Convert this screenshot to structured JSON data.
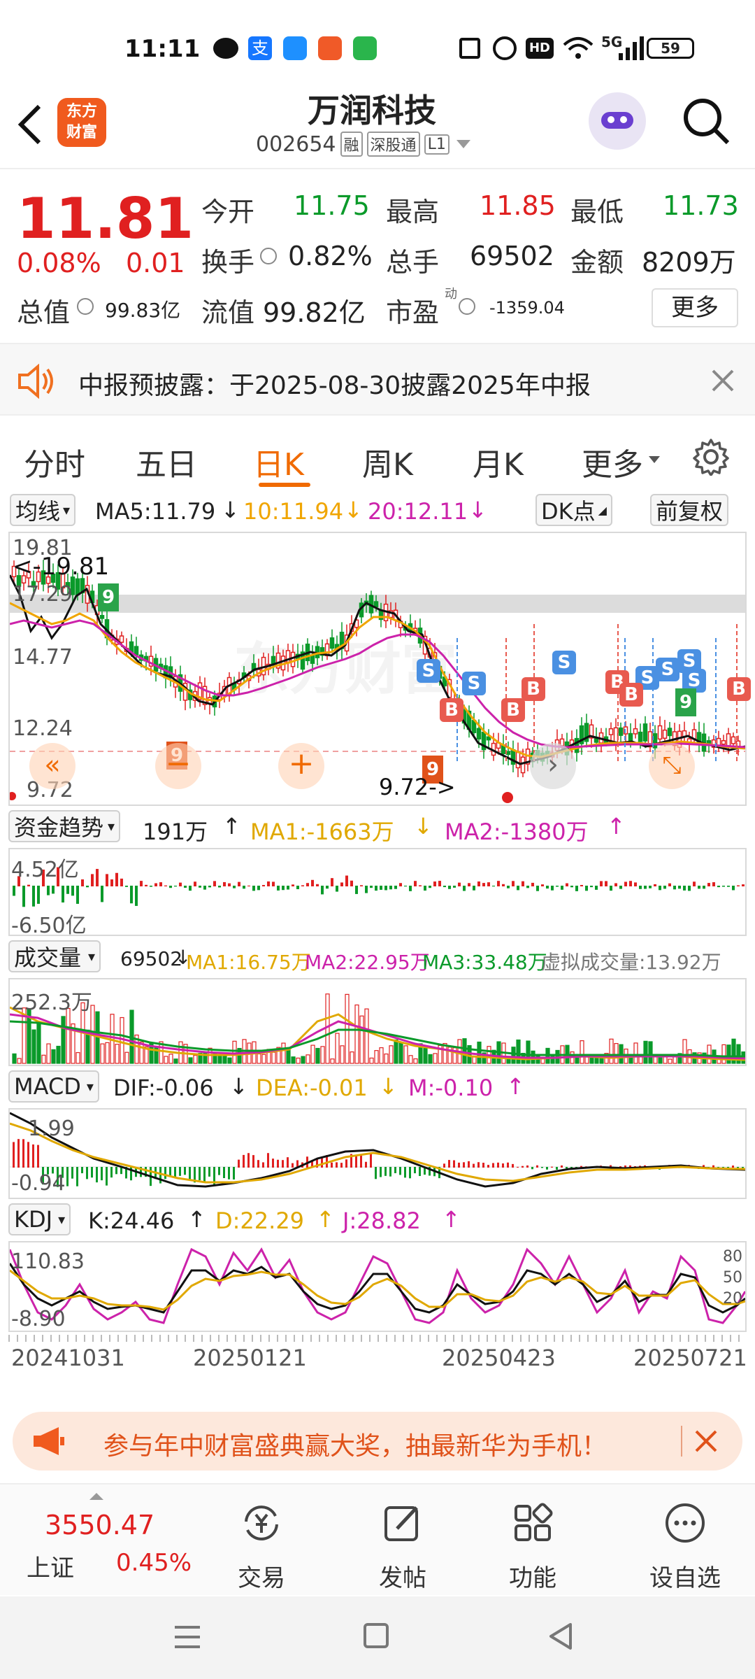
{
  "status_bar": {
    "time": "11:11",
    "signal": "5G",
    "battery": "59"
  },
  "header": {
    "title": "万润科技",
    "code": "002654",
    "tags": [
      "融",
      "深股通",
      "L1"
    ],
    "logo_text_1": "东方",
    "logo_text_2": "财富"
  },
  "quote": {
    "price": "11.81",
    "change_pct": "0.08%",
    "change": "0.01",
    "open_label": "今开",
    "open": "11.75",
    "high_label": "最高",
    "high": "11.85",
    "low_label": "最低",
    "low": "11.73",
    "turnover_label": "换手",
    "turnover": "0.82%",
    "volume_label": "总手",
    "volume": "69502",
    "amount_label": "金额",
    "amount": "8209万",
    "mktcap_label": "总值",
    "mktcap": "99.83亿",
    "float_label": "流值",
    "float": "99.82亿",
    "pe_label": "市盈",
    "pe_tag": "动",
    "pe": "-1359.04",
    "more_label": "更多"
  },
  "notice": {
    "text": "中报预披露：于2025-08-30披露2025年中报"
  },
  "tabs": [
    {
      "label": "分时"
    },
    {
      "label": "五日"
    },
    {
      "label": "日K"
    },
    {
      "label": "周K"
    },
    {
      "label": "月K"
    },
    {
      "label": "更多"
    }
  ],
  "kline": {
    "ma_select": "均线",
    "ma5": "MA5:11.79",
    "ma10": "10:11.94",
    "ma20": "20:12.11",
    "dk_label": "DK点",
    "adjust_label": "前复权",
    "y_labels": [
      "19.81",
      "17.29",
      "14.77",
      "12.24",
      "9.72"
    ],
    "high_note": "<-19.81",
    "low_note": "9.72->",
    "watermark": "东方财富"
  },
  "fund": {
    "select": "资金趋势",
    "value": "191万",
    "ma1": "MA1:-1663万",
    "ma2": "MA2:-1380万",
    "y_top": "4.52亿",
    "y_bottom": "-6.50亿"
  },
  "vol": {
    "select": "成交量",
    "value": "69502",
    "ma1": "MA1:16.75万",
    "ma2": "MA2:22.95万",
    "ma3": "MA3:33.48万",
    "virtual": "虚拟成交量:13.92万",
    "y_top": "252.3万"
  },
  "macd": {
    "select": "MACD",
    "dif": "DIF:-0.06",
    "dea": "DEA:-0.01",
    "m": "M:-0.10",
    "y_top": "1.99",
    "y_bottom": "-0.94"
  },
  "kdj": {
    "select": "KDJ",
    "k": "K:24.46",
    "d": "D:22.29",
    "j": "J:28.82",
    "y_top": "110.83",
    "y_bottom": "-8.90",
    "right_80": "80",
    "right_50": "50",
    "right_20": "20"
  },
  "x_labels": [
    "20241031",
    "20250121",
    "20250423",
    "20250721"
  ],
  "banner": {
    "text": "参与年中财富盛典赢大奖，抽最新华为手机！"
  },
  "bottom_nav": {
    "index_value": "3550.47",
    "index_name": "上证",
    "index_pct": "0.45%",
    "items": [
      {
        "label": "交易"
      },
      {
        "label": "发帖"
      },
      {
        "label": "功能"
      },
      {
        "label": "设自选"
      }
    ]
  },
  "colors": {
    "up": "#e02020",
    "down": "#0a9a2a",
    "accent": "#ff6a00",
    "ma10": "#f0a500",
    "ma20": "#cc22aa"
  }
}
